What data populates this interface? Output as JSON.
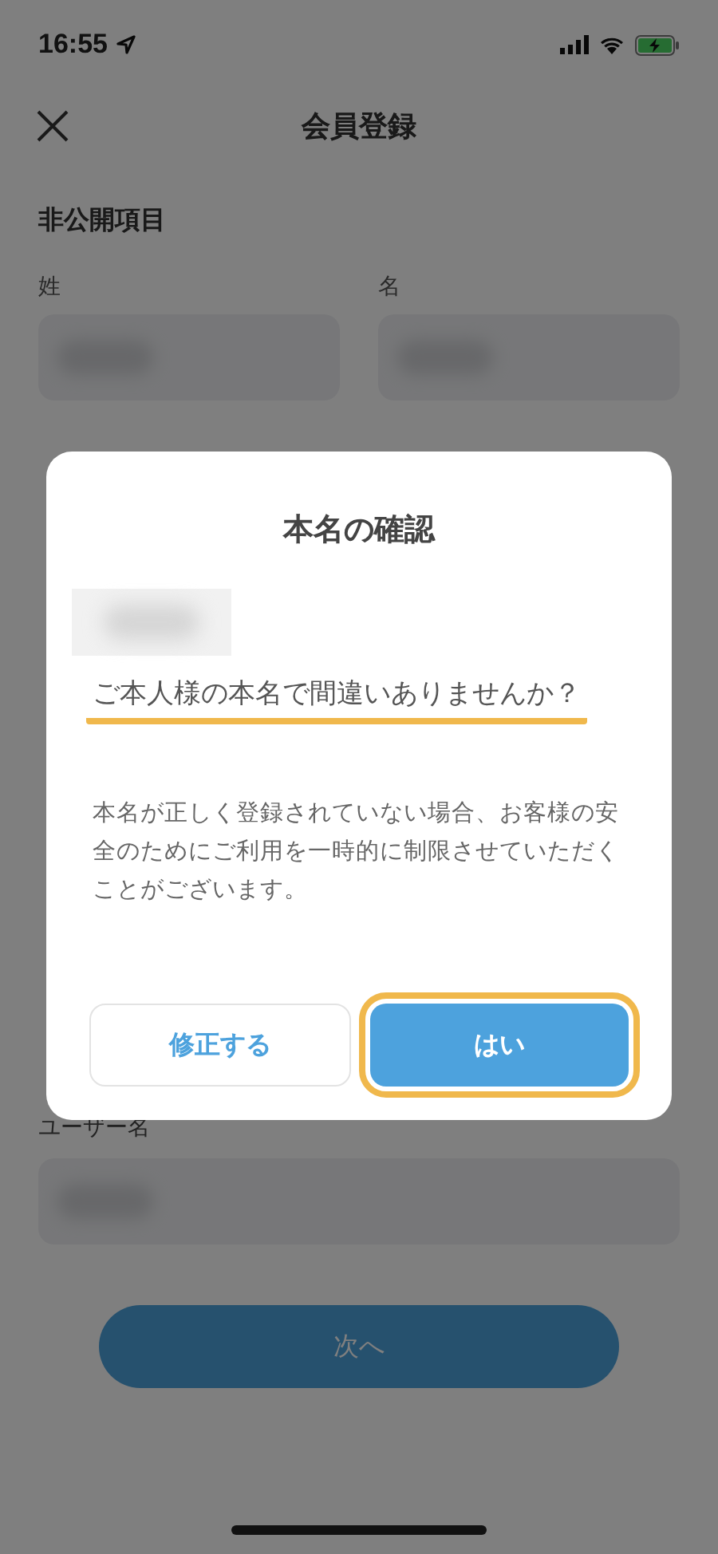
{
  "status_bar": {
    "time": "16:55"
  },
  "nav": {
    "title": "会員登録"
  },
  "form": {
    "section_title": "非公開項目",
    "name_fields": [
      {
        "label": "姓"
      },
      {
        "label": "名"
      }
    ],
    "username_label": "ユーザー名",
    "next_button": "次へ"
  },
  "dialog": {
    "title": "本名の確認",
    "question": "ご本人様の本名で間違いありませんか？",
    "question_highlighted": true,
    "message": "本名が正しく登録されていない場合、お客様の安全のためにご利用を一時的に制限させていただくことがございます。",
    "buttons": [
      {
        "label": "修正する",
        "kind": "secondary",
        "highlighted": false
      },
      {
        "label": "はい",
        "kind": "primary",
        "highlighted": true
      }
    ]
  }
}
